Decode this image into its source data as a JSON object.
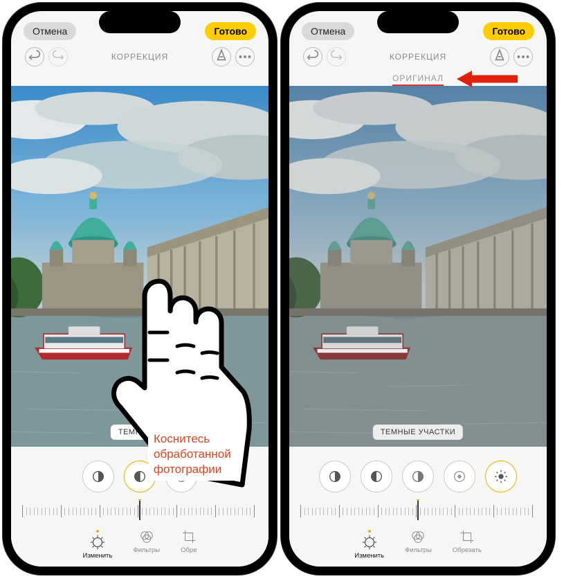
{
  "left": {
    "cancel": "Отмена",
    "done": "Готово",
    "mode": "КОРРЕКЦИЯ",
    "tool_label": "ТЕМНЫЕ У",
    "tabs": {
      "adjust": "Изменить",
      "filters": "Фильтры",
      "crop": "Обре"
    }
  },
  "right": {
    "cancel": "Отмена",
    "done": "Готово",
    "mode": "КОРРЕКЦИЯ",
    "original": "ОРИГИНАЛ",
    "tool_label": "ТЕМНЫЕ УЧАСТКИ",
    "tabs": {
      "adjust": "Изменить",
      "filters": "Фильтры",
      "crop": "Обрезать"
    }
  },
  "annotation": {
    "callout_l1": "Коснитесь",
    "callout_l2": "обработанной",
    "callout_l3": "фотографии"
  }
}
